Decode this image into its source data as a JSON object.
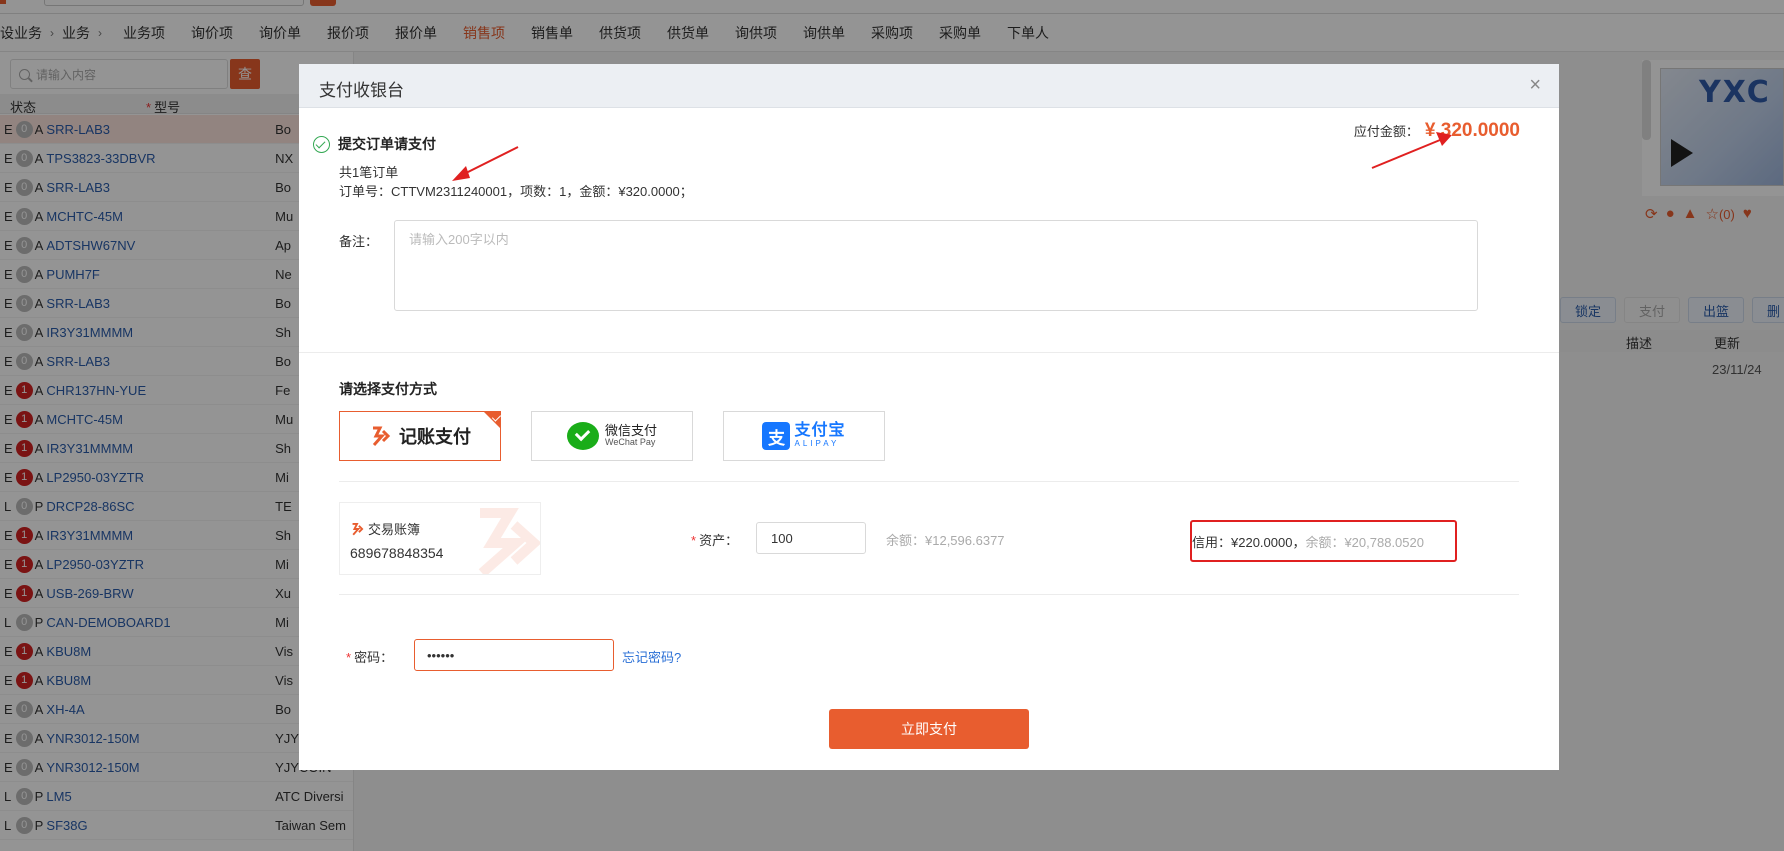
{
  "nav": {
    "crumbs": [
      "设业务",
      "业务"
    ],
    "items": [
      {
        "label": "业务项",
        "active": false
      },
      {
        "label": "询价项",
        "active": false
      },
      {
        "label": "询价单",
        "active": false
      },
      {
        "label": "报价项",
        "active": false
      },
      {
        "label": "报价单",
        "active": false
      },
      {
        "label": "销售项",
        "active": true
      },
      {
        "label": "销售单",
        "active": false
      },
      {
        "label": "供货项",
        "active": false
      },
      {
        "label": "供货单",
        "active": false
      },
      {
        "label": "询供项",
        "active": false
      },
      {
        "label": "询供单",
        "active": false
      },
      {
        "label": "采购项",
        "active": false
      },
      {
        "label": "采购单",
        "active": false
      },
      {
        "label": "下单人",
        "active": false
      }
    ]
  },
  "left": {
    "search_placeholder": "请输入内容",
    "search_button": "查",
    "col_status": "状态",
    "col_model": "型号",
    "rows": [
      {
        "status": "E",
        "badge": "0",
        "type": "A",
        "model": "SRR-LAB3",
        "mfr": "Bo",
        "selected": true
      },
      {
        "status": "E",
        "badge": "0",
        "type": "A",
        "model": "TPS3823-33DBVR",
        "mfr": "NX"
      },
      {
        "status": "E",
        "badge": "0",
        "type": "A",
        "model": "SRR-LAB3",
        "mfr": "Bo"
      },
      {
        "status": "E",
        "badge": "0",
        "type": "A",
        "model": "MCHTC-45M",
        "mfr": "Mu"
      },
      {
        "status": "E",
        "badge": "0",
        "type": "A",
        "model": "ADTSHW67NV",
        "mfr": "Ap"
      },
      {
        "status": "E",
        "badge": "0",
        "type": "A",
        "model": "PUMH7F",
        "mfr": "Ne"
      },
      {
        "status": "E",
        "badge": "0",
        "type": "A",
        "model": "SRR-LAB3",
        "mfr": "Bo"
      },
      {
        "status": "E",
        "badge": "0",
        "type": "A",
        "model": "IR3Y31MMMM",
        "mfr": "Sh"
      },
      {
        "status": "E",
        "badge": "0",
        "type": "A",
        "model": "SRR-LAB3",
        "mfr": "Bo"
      },
      {
        "status": "E",
        "badge": "1",
        "type": "A",
        "model": "CHR137HN-YUE",
        "mfr": "Fe"
      },
      {
        "status": "E",
        "badge": "1",
        "type": "A",
        "model": "MCHTC-45M",
        "mfr": "Mu"
      },
      {
        "status": "E",
        "badge": "1",
        "type": "A",
        "model": "IR3Y31MMMM",
        "mfr": "Sh"
      },
      {
        "status": "E",
        "badge": "1",
        "type": "A",
        "model": "LP2950-03YZTR",
        "mfr": "Mi"
      },
      {
        "status": "L",
        "badge": "0",
        "type": "P",
        "model": "DRCP28-86SC",
        "mfr": "TE"
      },
      {
        "status": "E",
        "badge": "1",
        "type": "A",
        "model": "IR3Y31MMMM",
        "mfr": "Sh"
      },
      {
        "status": "E",
        "badge": "1",
        "type": "A",
        "model": "LP2950-03YZTR",
        "mfr": "Mi"
      },
      {
        "status": "E",
        "badge": "1",
        "type": "A",
        "model": "USB-269-BRW",
        "mfr": "Xu"
      },
      {
        "status": "L",
        "badge": "0",
        "type": "P",
        "model": "CAN-DEMOBOARD1",
        "mfr": "Mi"
      },
      {
        "status": "E",
        "badge": "1",
        "type": "A",
        "model": "KBU8M",
        "mfr": "Vis"
      },
      {
        "status": "E",
        "badge": "1",
        "type": "A",
        "model": "KBU8M",
        "mfr": "Vis"
      },
      {
        "status": "E",
        "badge": "0",
        "type": "A",
        "model": "XH-4A",
        "mfr": "Bo"
      },
      {
        "status": "E",
        "badge": "0",
        "type": "A",
        "model": "YNR3012-150M",
        "mfr": "YJY"
      },
      {
        "status": "E",
        "badge": "0",
        "type": "A",
        "model": "YNR3012-150M",
        "mfr": "YJYCOIN"
      },
      {
        "status": "L",
        "badge": "0",
        "type": "P",
        "model": "LM5",
        "mfr": "ATC Diversi"
      },
      {
        "status": "L",
        "badge": "0",
        "type": "P",
        "model": "SF38G",
        "mfr": "Taiwan Sem"
      }
    ]
  },
  "right": {
    "thumb_logo": "YXC",
    "like_count": "(0)",
    "buttons": [
      {
        "label": "锁定",
        "disabled": false
      },
      {
        "label": "支付",
        "disabled": true
      },
      {
        "label": "出篮",
        "disabled": false
      },
      {
        "label": "删",
        "disabled": false
      }
    ],
    "col_desc": "描述",
    "col_update": "更新",
    "date": "23/11/24"
  },
  "modal": {
    "title": "支付收银台",
    "submit_text": "提交订单请支付",
    "order_count": "共1笔订单",
    "order_detail": "订单号：CTTVM2311240001，项数：1，金额：¥320.0000；",
    "amount_label": "应付金额：",
    "amount_value": "¥ 320.0000",
    "remark_label": "备注：",
    "remark_placeholder": "请输入200字以内",
    "pay_method_title": "请选择支付方式",
    "pay_options": {
      "jz": "记账支付",
      "wx_cn": "微信支付",
      "wx_en": "WeChat Pay",
      "ali_cn": "支付宝",
      "ali_en": "ALIPAY"
    },
    "account_name": "交易账簿",
    "account_no": "689678848354",
    "asset_label": "资产：",
    "asset_value": "100",
    "asset_balance": "余额：¥12,596.6377",
    "credit_label": "信用：¥220.0000，",
    "credit_balance": "余额：¥20,788.0520",
    "password_label": "密码：",
    "password_value": "••••••",
    "forgot_password": "忘记密码?",
    "pay_now": "立即支付"
  },
  "colors": {
    "accent": "#e85d2f",
    "wechat": "#1aad19",
    "alipay": "#1677ff",
    "highlight_box": "#e02020"
  }
}
